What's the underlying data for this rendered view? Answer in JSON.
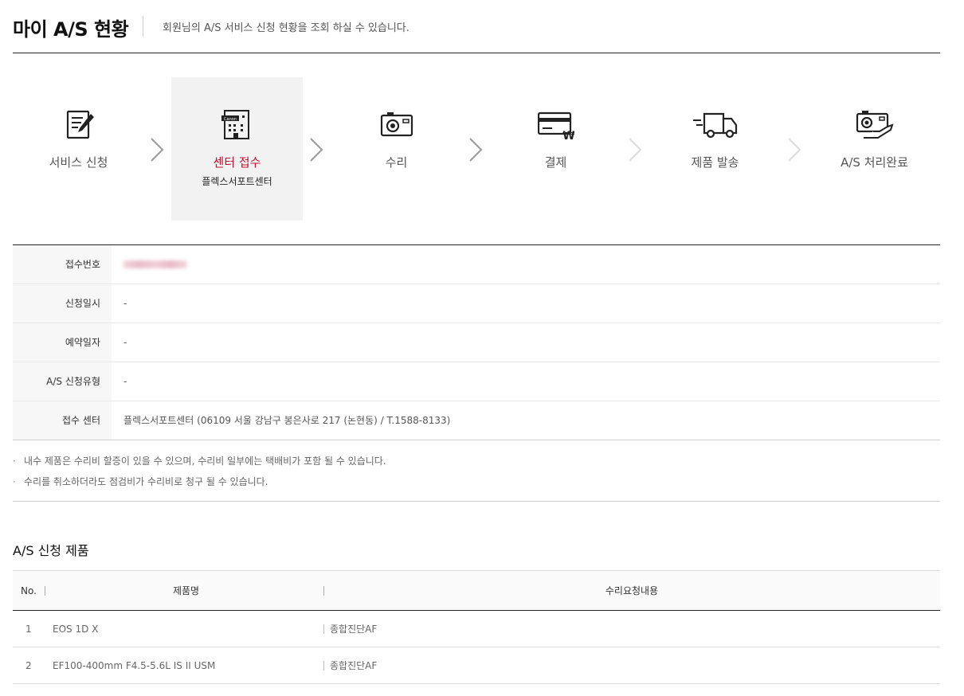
{
  "header": {
    "title": "마이 A/S 현황",
    "description": "회원님의 A/S 서비스 신청 현황을 조회 하실 수 있습니다."
  },
  "steps": [
    {
      "label": "서비스 신청",
      "icon": "form-pen-icon",
      "sub": ""
    },
    {
      "label": "센터 접수",
      "icon": "canon-building-icon",
      "sub": "플렉스서포트센터",
      "active": true
    },
    {
      "label": "수리",
      "icon": "camera-icon",
      "sub": ""
    },
    {
      "label": "결제",
      "icon": "credit-card-won-icon",
      "sub": ""
    },
    {
      "label": "제품 발송",
      "icon": "delivery-truck-icon",
      "sub": ""
    },
    {
      "label": "A/S 처리완료",
      "icon": "camera-hand-icon",
      "sub": ""
    }
  ],
  "info": {
    "receipt_no_label": "접수번호",
    "receipt_no_value": "",
    "apply_date_label": "신청일시",
    "apply_date_value": "-",
    "reserve_date_label": "예약일자",
    "reserve_date_value": "-",
    "as_type_label": "A/S 신청유형",
    "as_type_value": "-",
    "center_label": "접수 센터",
    "center_value": "플렉스서포트센터 (06109 서울 강남구 봉은사로 217 (논현동)  / T.1588-8133)"
  },
  "notes": [
    "내수 제품은 수리비 할증이 있을 수 있으며, 수리비 일부에는 택배비가 포함 될 수 있습니다.",
    "수리를 취소하더라도 점검비가 수리비로 청구 될 수 있습니다."
  ],
  "products": {
    "section_title": "A/S 신청 제품",
    "headers": {
      "no": "No.",
      "name": "제품명",
      "request": "수리요청내용"
    },
    "rows": [
      {
        "no": "1",
        "name": "EOS 1D X",
        "request": "종합진단AF"
      },
      {
        "no": "2",
        "name": "EF100-400mm F4.5-5.6L IS II USM",
        "request": "종합진단AF"
      }
    ]
  },
  "colors": {
    "accent": "#c8102e",
    "active_step_bg": "#f2f2f2"
  }
}
